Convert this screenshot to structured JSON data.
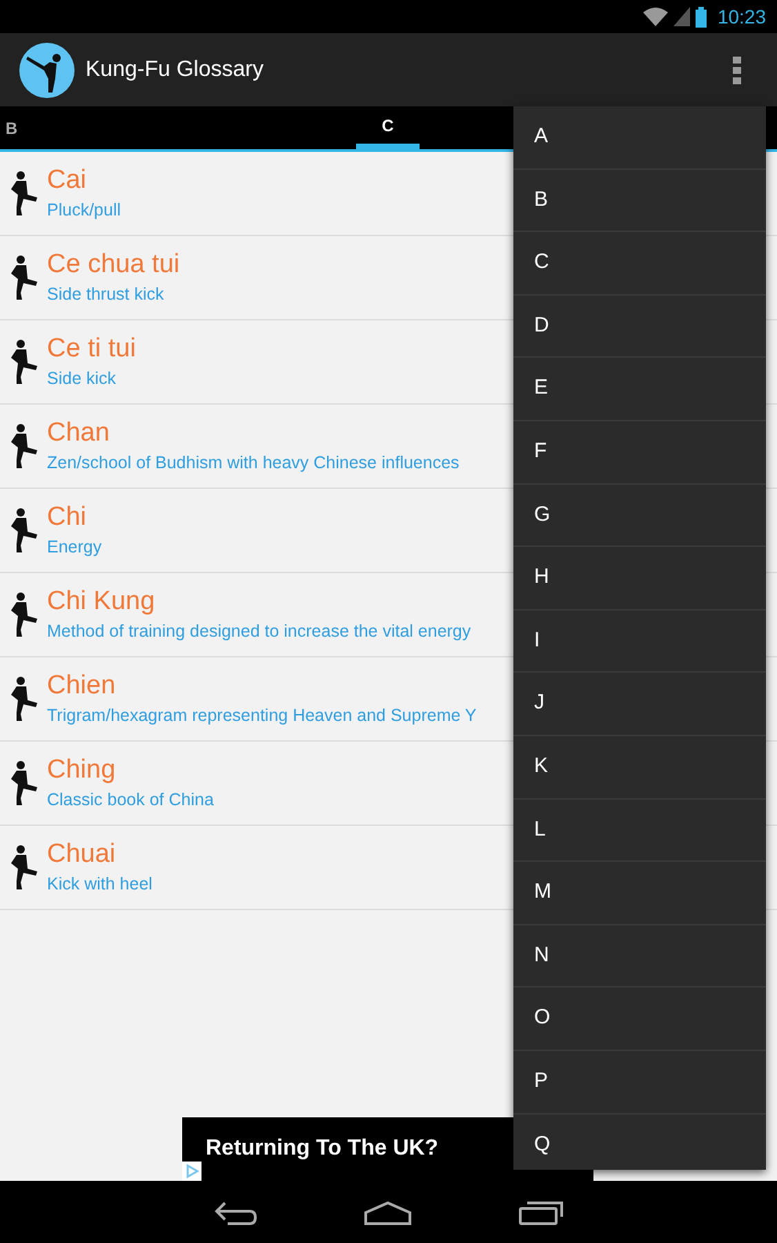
{
  "status_bar": {
    "time": "10:23"
  },
  "action_bar": {
    "title": "Kung-Fu Glossary"
  },
  "tabs": [
    {
      "label": "B",
      "selected": false
    },
    {
      "label": "C",
      "selected": true
    }
  ],
  "entries": [
    {
      "term": "Cai",
      "meaning": "Pluck/pull"
    },
    {
      "term": "Ce chua tui",
      "meaning": "Side thrust kick"
    },
    {
      "term": "Ce ti tui",
      "meaning": "Side kick"
    },
    {
      "term": "Chan",
      "meaning": "Zen/school of Budhism with heavy Chinese influences"
    },
    {
      "term": "Chi",
      "meaning": "Energy"
    },
    {
      "term": "Chi Kung",
      "meaning": "Method of training designed to increase the vital energy"
    },
    {
      "term": "Chien",
      "meaning": "Trigram/hexagram representing Heaven and Supreme Y"
    },
    {
      "term": "Ching",
      "meaning": "Classic book of China"
    },
    {
      "term": "Chuai",
      "meaning": "Kick with heel"
    }
  ],
  "ad": {
    "text": "Returning To The UK?"
  },
  "menu": [
    "A",
    "B",
    "C",
    "D",
    "E",
    "F",
    "G",
    "H",
    "I",
    "J",
    "K",
    "L",
    "M",
    "N",
    "O",
    "P",
    "Q"
  ]
}
